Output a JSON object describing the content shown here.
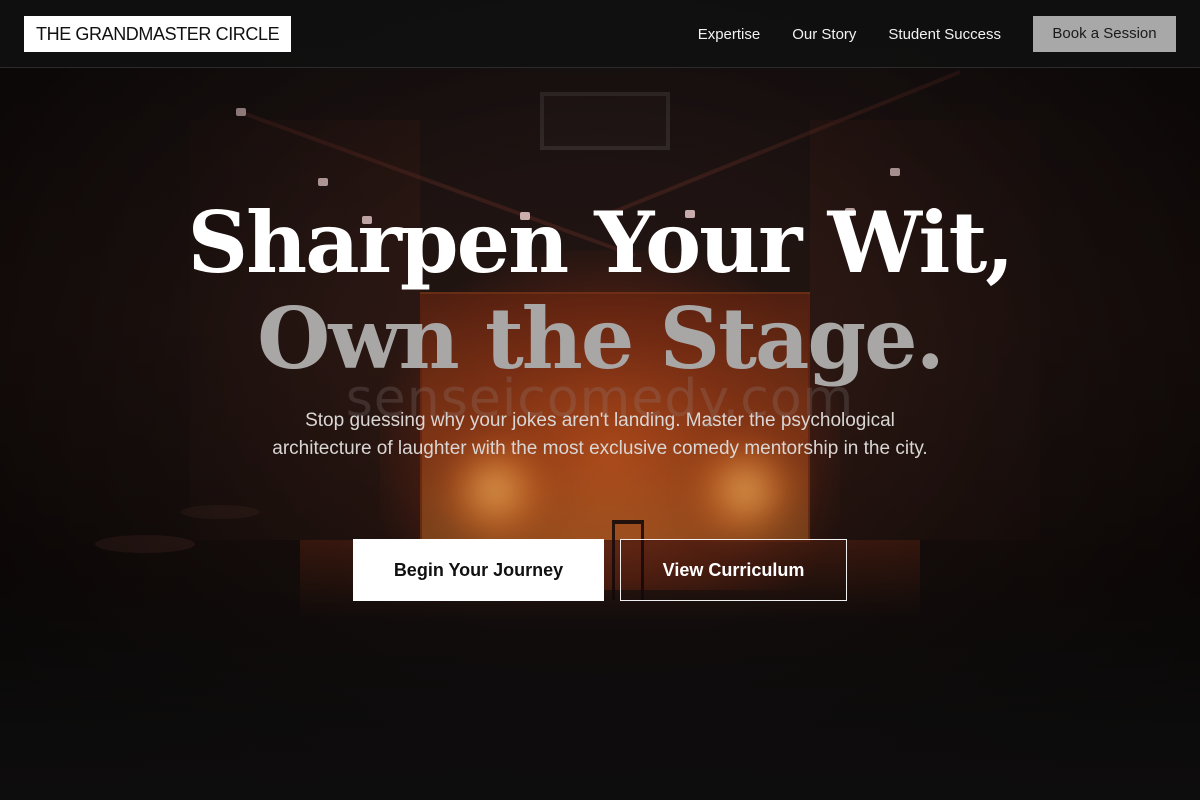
{
  "brand": {
    "name": "THE GRANDMASTER CIRCLE"
  },
  "nav": {
    "links": [
      "Expertise",
      "Our Story",
      "Student Success"
    ],
    "cta_label": "Book a Session"
  },
  "hero": {
    "headline_line1": "Sharpen Your Wit,",
    "headline_line2": "Own the Stage.",
    "watermark": "senseicomedy.com",
    "subtitle": "Stop guessing why your jokes aren't landing. Master the psychological architecture of laughter with the most exclusive comedy mentorship in the city.",
    "primary_button": "Begin Your Journey",
    "secondary_button": "View Curriculum"
  },
  "colors": {
    "nav_background": "#101010",
    "accent_button": "#a8a8a8",
    "headline_secondary": "#a9a7a6",
    "stage_glow": "#d25a1e"
  }
}
